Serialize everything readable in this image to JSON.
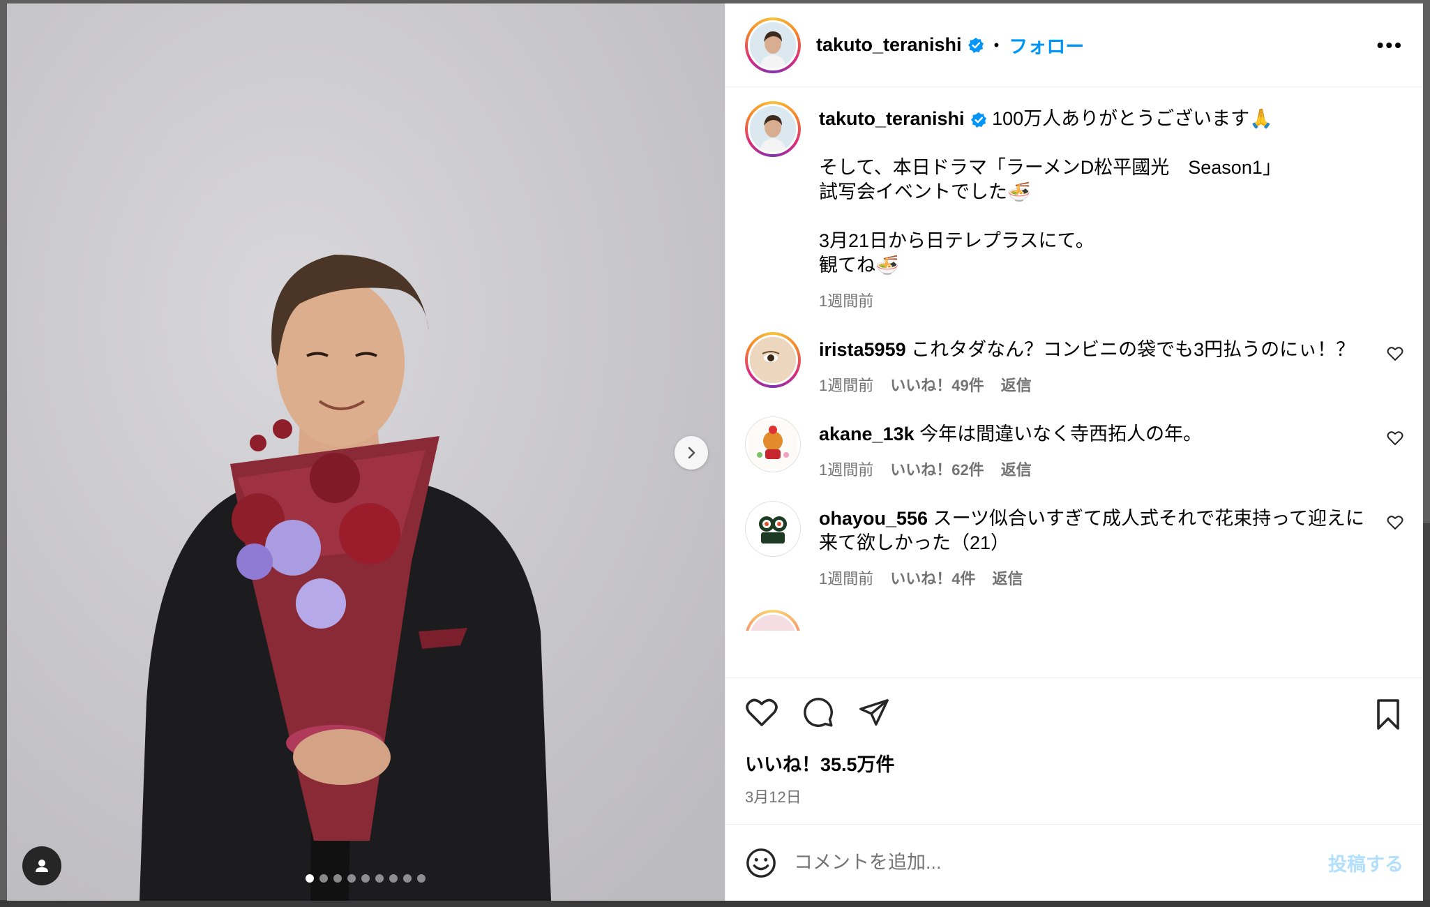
{
  "post": {
    "author": "takuto_teranishi",
    "follow_label": "フォロー",
    "dot_separator": "•",
    "more_label": "•••",
    "verified": true
  },
  "caption": {
    "username": "takuto_teranishi",
    "text": "100万人ありがとうございます🙏\n\nそして、本日ドラマ「ラーメンD松平國光　Season1」\n試写会イベントでした🍜\n\n3月21日から日テレプラスにて。\n観てね🍜",
    "time": "1週間前"
  },
  "comments": [
    {
      "username": "irista5959",
      "text": "これタダなん？コンビニの袋でも3円払うのにぃ！？",
      "time": "1週間前",
      "likes": "いいね！49件",
      "reply": "返信"
    },
    {
      "username": "akane_13k",
      "text": "今年は間違いなく寺西拓人の年。",
      "time": "1週間前",
      "likes": "いいね！62件",
      "reply": "返信"
    },
    {
      "username": "ohayou_556",
      "text": "スーツ似合いすぎて成人式それで花束持って迎えに来て欲しかった（21）",
      "time": "1週間前",
      "likes": "いいね！4件",
      "reply": "返信"
    }
  ],
  "footer": {
    "likes": "いいね！35.5万件",
    "date": "3月12日"
  },
  "comment_box": {
    "placeholder": "コメントを追加...",
    "post_label": "投稿する"
  },
  "carousel": {
    "total": 9,
    "current": 1
  },
  "icons": {
    "like": "heart-icon",
    "comment": "comment-icon",
    "share": "share-icon",
    "save": "bookmark-icon",
    "emoji": "emoji-icon",
    "next": "chevron-right-icon",
    "tag": "user-tag-icon"
  },
  "colors": {
    "link": "#0095f6",
    "verified": "#0095f6",
    "muted": "#737373",
    "post_disabled": "#b2dffc"
  }
}
